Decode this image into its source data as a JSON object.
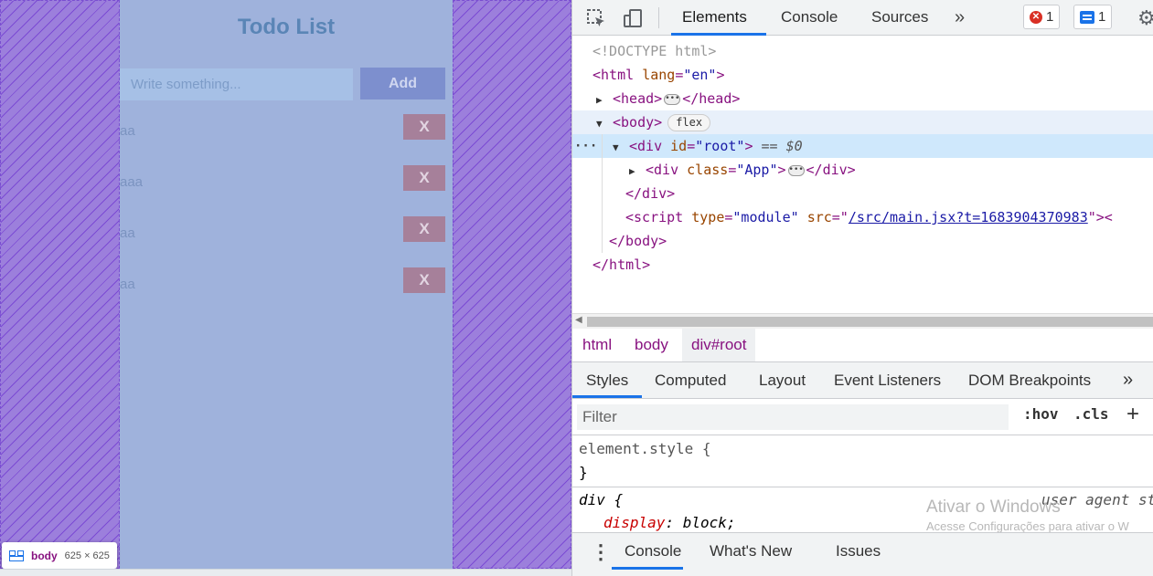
{
  "app": {
    "title": "Todo List",
    "input_placeholder": "Write something...",
    "add_label": "Add",
    "delete_label": "X",
    "todos": [
      "aa",
      "aaa",
      "aa",
      "aa"
    ],
    "tooltip": {
      "name": "body",
      "dimensions": "625 × 625"
    }
  },
  "devtools": {
    "tabs": {
      "elements": "Elements",
      "console": "Console",
      "sources": "Sources",
      "more": "»"
    },
    "badges": {
      "errors": "1",
      "messages": "1"
    },
    "dom": {
      "doctype": "<!DOCTYPE html>",
      "html_open": "<html",
      "lang_attr": "lang",
      "lang_val": "\"en\"",
      "head_open": "<head>",
      "head_close": "</head>",
      "body_open": "<body>",
      "flex_pill": "flex",
      "div_open": "<div",
      "id_attr": "id",
      "id_val": "\"root\"",
      "dollar0": "== $0",
      "class_attr": "class",
      "class_val": "\"App\"",
      "div_close": "</div>",
      "script_open": "<script",
      "type_attr": "type",
      "type_val": "\"module\"",
      "src_attr": "src",
      "src_val": "/src/main.jsx?t=1683904370983",
      "body_close": "</body>",
      "html_close": "</html>"
    },
    "breadcrumb": [
      "html",
      "body",
      "div#root"
    ],
    "styles_tabs": [
      "Styles",
      "Computed",
      "Layout",
      "Event Listeners",
      "DOM Breakpoints",
      "»"
    ],
    "filter_placeholder": "Filter",
    "hov": ":hov",
    "cls": ".cls",
    "plus": "+",
    "element_style": {
      "selector": "element.style {",
      "close": "}"
    },
    "div_rule": {
      "selector": "div {",
      "prop": "display",
      "value": "block;",
      "source": "user agent st"
    },
    "watermark": {
      "line1": "Ativar o Windows",
      "line2": "Acesse Configurações para ativar o W"
    },
    "drawer_tabs": [
      "Console",
      "What's New",
      "Issues"
    ]
  }
}
